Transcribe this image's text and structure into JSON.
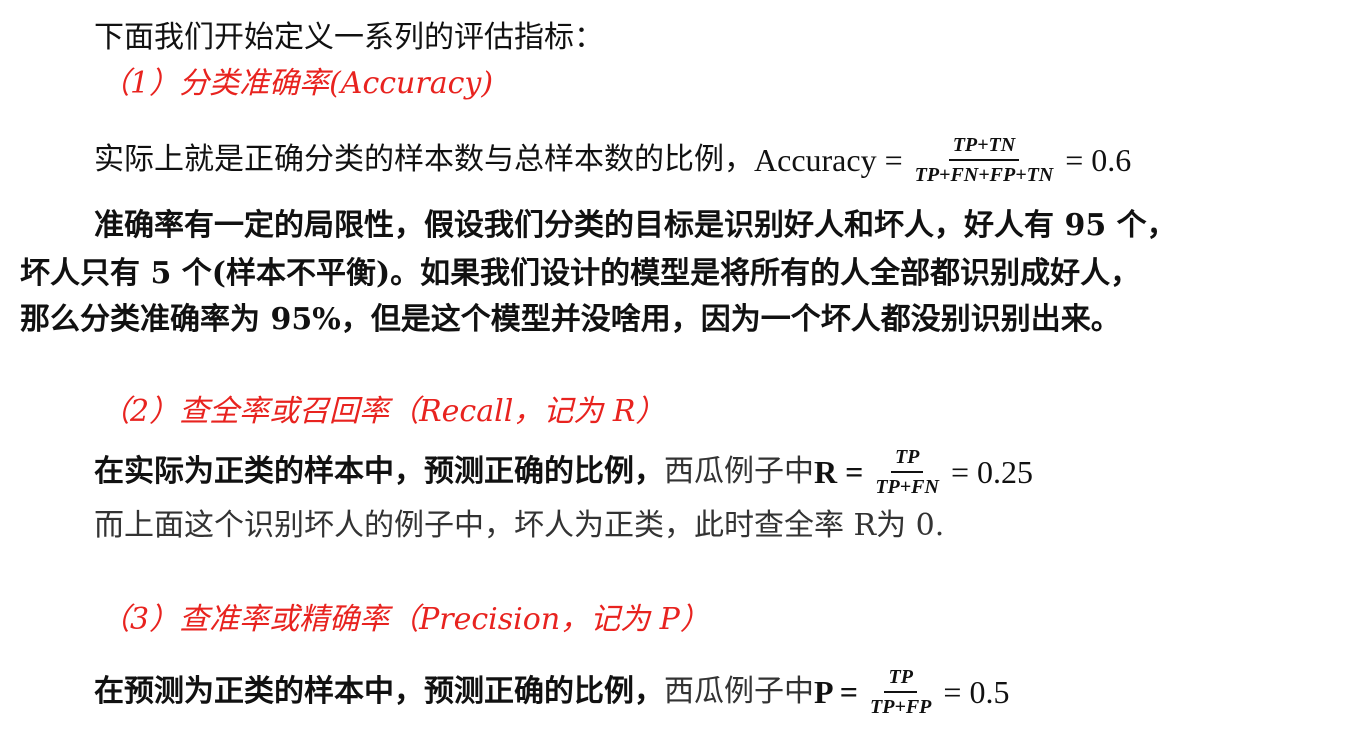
{
  "intro": "下面我们开始定义一系列的评估指标：",
  "section1": {
    "heading": "（1）分类准确率(Accuracy)",
    "definition": "实际上就是正确分类的样本数与总样本数的比例，",
    "formula": {
      "lhs": "Accuracy =",
      "numerator": "TP+TN",
      "denominator": "TP+FN+FP+TN",
      "rhs": "= 0.6"
    },
    "paragraph": {
      "p1_a": "准确率有一定的局限性，假设我们分类的目标是识别好人和坏人，好人有",
      "p1_num": " 95 ",
      "p1_b": "个，",
      "p2_a": "坏人只有",
      "p2_num": " 5 ",
      "p2_b": "个(样本不平衡)。如果我们设计的模型是将所有的人全部都识别成好人，",
      "p3_a": "那么分类准确率为",
      "p3_num": " 95%",
      "p3_b": "，但是这个模型并没啥用，因为一个坏人都没别识别出来。"
    }
  },
  "section2": {
    "heading": "（2）查全率或召回率（Recall，记为 R）",
    "definition_bold": "在实际为正类的样本中，预测正确的比例，",
    "definition_light": "西瓜例子中",
    "formula": {
      "lhs": "R =",
      "numerator": "TP",
      "denominator": "TP+FN",
      "rhs": "= 0.25"
    },
    "note": "而上面这个识别坏人的例子中，坏人为正类，此时查全率 R为 0."
  },
  "section3": {
    "heading": "（3）查准率或精确率（Precision，记为 P）",
    "definition_bold": "在预测为正类的样本中，预测正确的比例，",
    "definition_light": "西瓜例子中",
    "formula": {
      "lhs": "P =",
      "numerator": "TP",
      "denominator": "TP+FP",
      "rhs": "= 0.5"
    }
  },
  "colors": {
    "heading_red": "#e8231f",
    "text": "#111111"
  }
}
